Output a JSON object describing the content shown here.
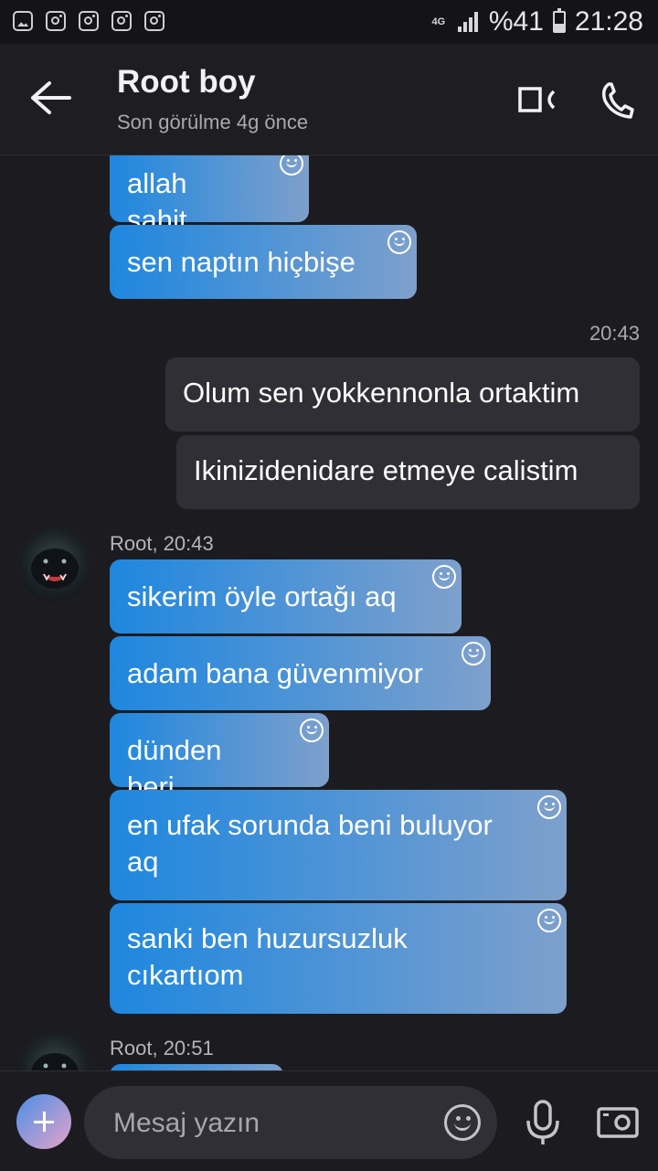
{
  "status_bar": {
    "network": "4G",
    "battery": "%41",
    "battery_level": 0.41,
    "time": "21:28"
  },
  "header": {
    "title": "Root boy",
    "subtitle": "Son görülme 4g önce"
  },
  "messages": {
    "m1": "allah sahit",
    "m2": "sen naptın hiçbişe",
    "t1": "20:43",
    "m3": "Olum sen yokkennonla ortaktim",
    "m4": "Ikinizidenidare etmeye calistim",
    "g1_meta": "Root, 20:43",
    "m5": "sikerim öyle ortağı aq",
    "m6": "adam bana güvenmiyor",
    "m7": "dünden beri",
    "m8": "en ufak sorunda beni buluyor aq",
    "m9": "sanki ben huzursuzluk cıkartıom",
    "g2_meta": "Root, 20:51"
  },
  "composer": {
    "placeholder": "Mesaj yazın"
  },
  "colors": {
    "bubble_gradient_start": "#1e87df",
    "bubble_gradient_end": "#7ea0cc",
    "outgoing_bubble": "#2f2f35",
    "background": "#1c1c20"
  }
}
